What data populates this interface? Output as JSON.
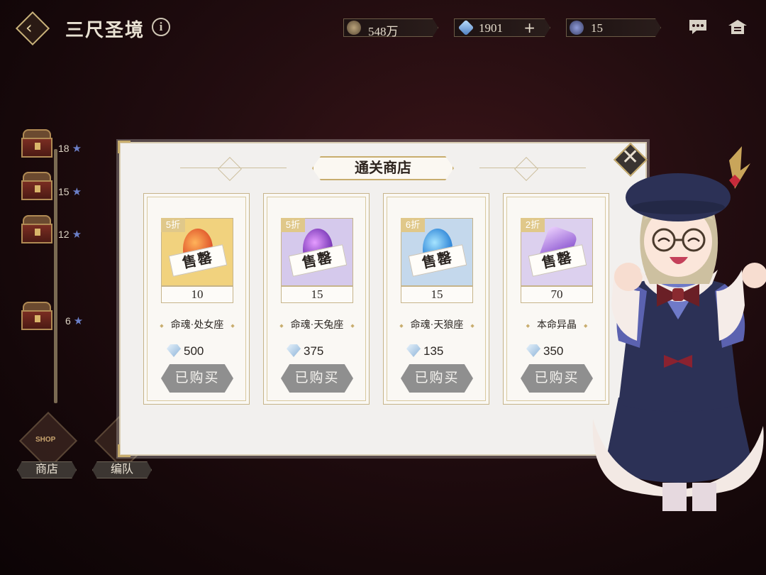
{
  "header": {
    "title": "三尺圣境",
    "info_symbol": "i",
    "resources": [
      {
        "icon": "coin-icon",
        "value": "548万"
      },
      {
        "icon": "crystal-icon",
        "value": "1901",
        "has_plus": true
      },
      {
        "icon": "token-icon",
        "value": "15"
      }
    ]
  },
  "progress": {
    "milestones": [
      {
        "stars": "18"
      },
      {
        "stars": "15"
      },
      {
        "stars": "12"
      },
      {
        "stars": "6"
      }
    ]
  },
  "bottom_buttons": {
    "shop_label": "商店",
    "shop_emblem": "SHOP",
    "team_label": "编队"
  },
  "shop": {
    "title": "通关商店",
    "items": [
      {
        "discount": "5折",
        "sold_label": "售罄",
        "quantity": "10",
        "name": "命魂·处女座",
        "price": "500",
        "bought_label": "已购买",
        "bg": "#f1d27e",
        "orb": "#e0562c"
      },
      {
        "discount": "5折",
        "sold_label": "售罄",
        "quantity": "15",
        "name": "命魂·天兔座",
        "price": "375",
        "bought_label": "已购买",
        "bg": "#d5c9ec",
        "orb": "#7a3ab8"
      },
      {
        "discount": "6折",
        "sold_label": "售罄",
        "quantity": "15",
        "name": "命魂·天狼座",
        "price": "135",
        "bought_label": "已购买",
        "bg": "#c4d8ec",
        "orb": "#2f86d8"
      },
      {
        "discount": "2折",
        "sold_label": "售罄",
        "quantity": "70",
        "name": "本命异晶",
        "price": "350",
        "bought_label": "已购买",
        "bg": "#dcd0ee",
        "orb": "#9b6ad8"
      }
    ]
  },
  "colors": {
    "accent_gold": "#c8ad6e",
    "panel_bg": "#f2f0ee",
    "button_grey": "#8f8f8f"
  }
}
